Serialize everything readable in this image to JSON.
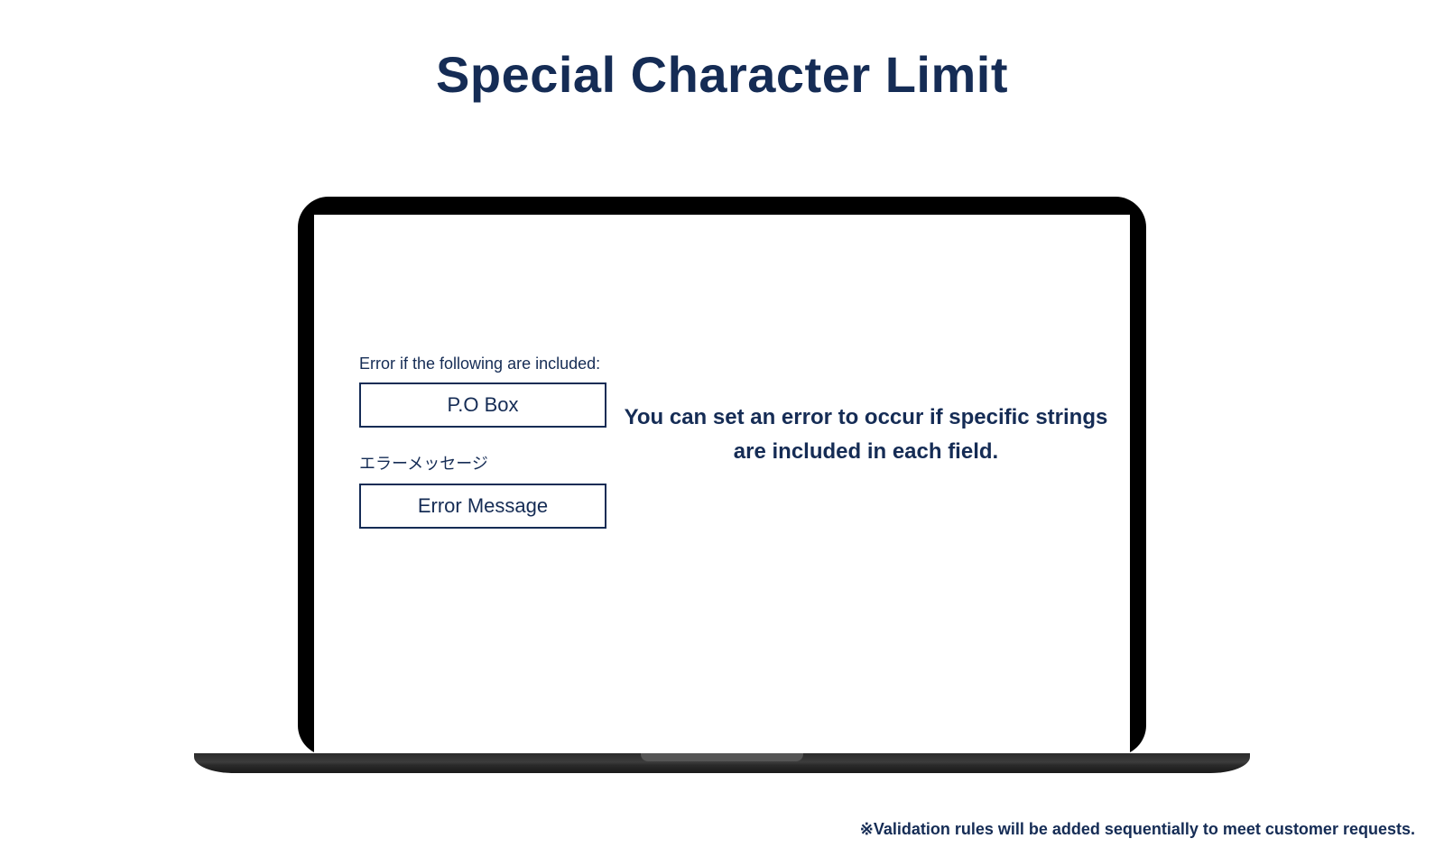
{
  "title": "Special Character Limit",
  "form": {
    "label1": "Error if the following are included:",
    "input1": "P.O Box",
    "label2": "エラーメッセージ",
    "input2": "Error Message"
  },
  "description": "You can set an error to occur if specific strings are included in each field.",
  "footnote": "※Validation rules will be added sequentially to meet customer requests."
}
